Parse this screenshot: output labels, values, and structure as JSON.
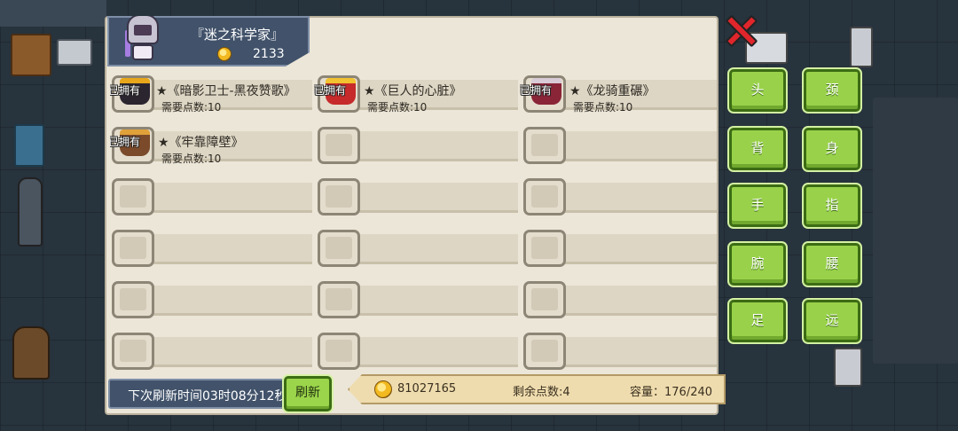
{
  "header": {
    "title": "『迷之科学家』",
    "gold": "2133"
  },
  "items": [
    {
      "name": "★《暗影卫士-黑夜赞歌》",
      "cost": "需要点数:10",
      "owned": "已拥有",
      "art_color": "#2b2530",
      "accent": "#e8a61a"
    },
    {
      "name": "★《巨人的心脏》",
      "cost": "需要点数:10",
      "owned": "已拥有",
      "art_color": "#c62a2a",
      "accent": "#f2c230"
    },
    {
      "name": "★《龙骑重碾》",
      "cost": "需要点数:10",
      "owned": "已拥有",
      "art_color": "#8a2437",
      "accent": "#d8cbd6"
    },
    {
      "name": "★《牢靠障壁》",
      "cost": "需要点数:10",
      "owned": "已拥有",
      "art_color": "#7a4a2a",
      "accent": "#e0a13a"
    }
  ],
  "footer": {
    "refresh_text": "下次刷新时间03时08分12秒",
    "refresh_button": "刷新",
    "total_gold": "81027165",
    "remaining_points": "剩余点数:4",
    "capacity": "容量：176/240"
  },
  "categories": [
    "头",
    "颈",
    "背",
    "身",
    "手",
    "指",
    "腕",
    "腰",
    "足",
    "远"
  ],
  "colors": {
    "panel": "#ece6d8",
    "button_green": "#99d24a",
    "header_blue": "#41526a",
    "close_red": "#e0262c"
  }
}
